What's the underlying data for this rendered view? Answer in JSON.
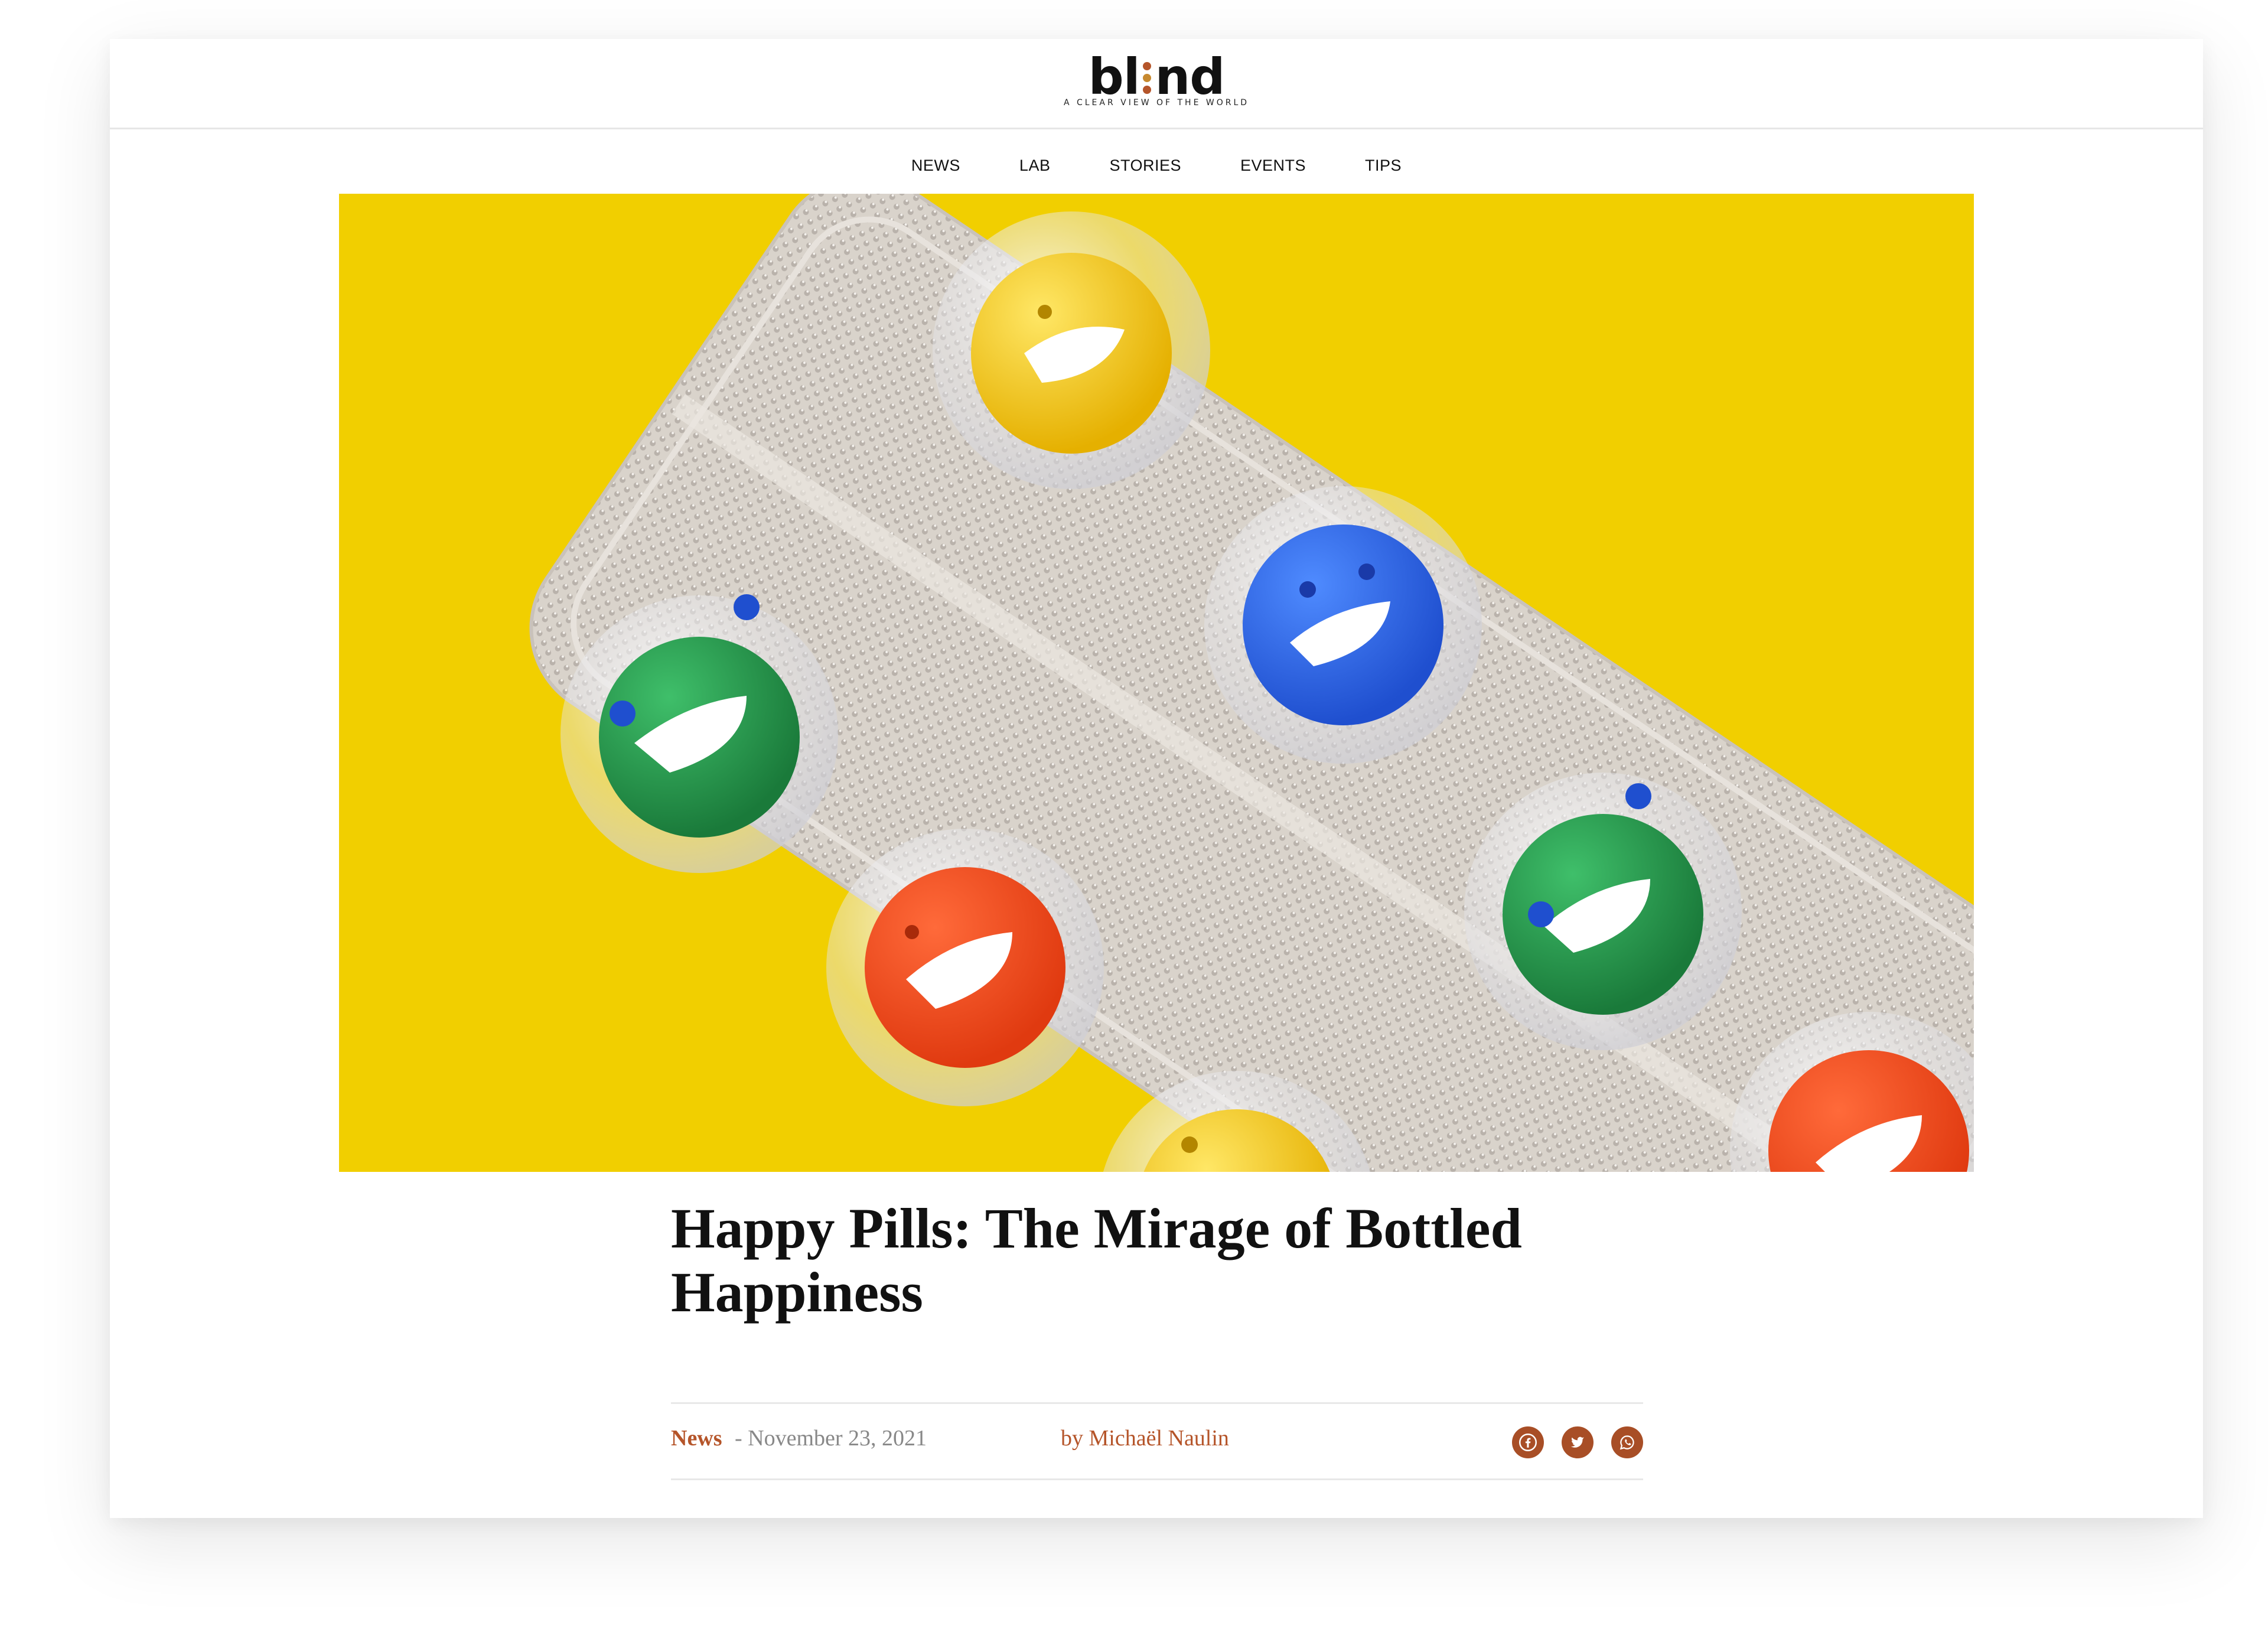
{
  "site": {
    "logo_prefix": "bl",
    "logo_suffix": "nd",
    "tagline": "A CLEAR VIEW OF THE WORLD",
    "logo_dot_colors": [
      "#b5552a",
      "#c7892f",
      "#b5552a"
    ]
  },
  "nav": {
    "items": [
      "NEWS",
      "LAB",
      "STORIES",
      "EVENTS",
      "TIPS"
    ]
  },
  "hero": {
    "background_color": "#f1cf00",
    "pill_colors": [
      "yellow",
      "green",
      "orange-red",
      "blue",
      "green",
      "yellow",
      "orange-red"
    ]
  },
  "article": {
    "title": "Happy Pills: The Mirage of Bottled Happiness",
    "category": "News",
    "date_separator": " - ",
    "date": "November 23, 2021",
    "author": "by Michaël Naulin",
    "share_icons": [
      "facebook-icon",
      "twitter-icon",
      "whatsapp-icon"
    ]
  },
  "colors": {
    "accent": "#b5552a",
    "share_button": "#a84e26",
    "meta_muted": "#888888"
  }
}
